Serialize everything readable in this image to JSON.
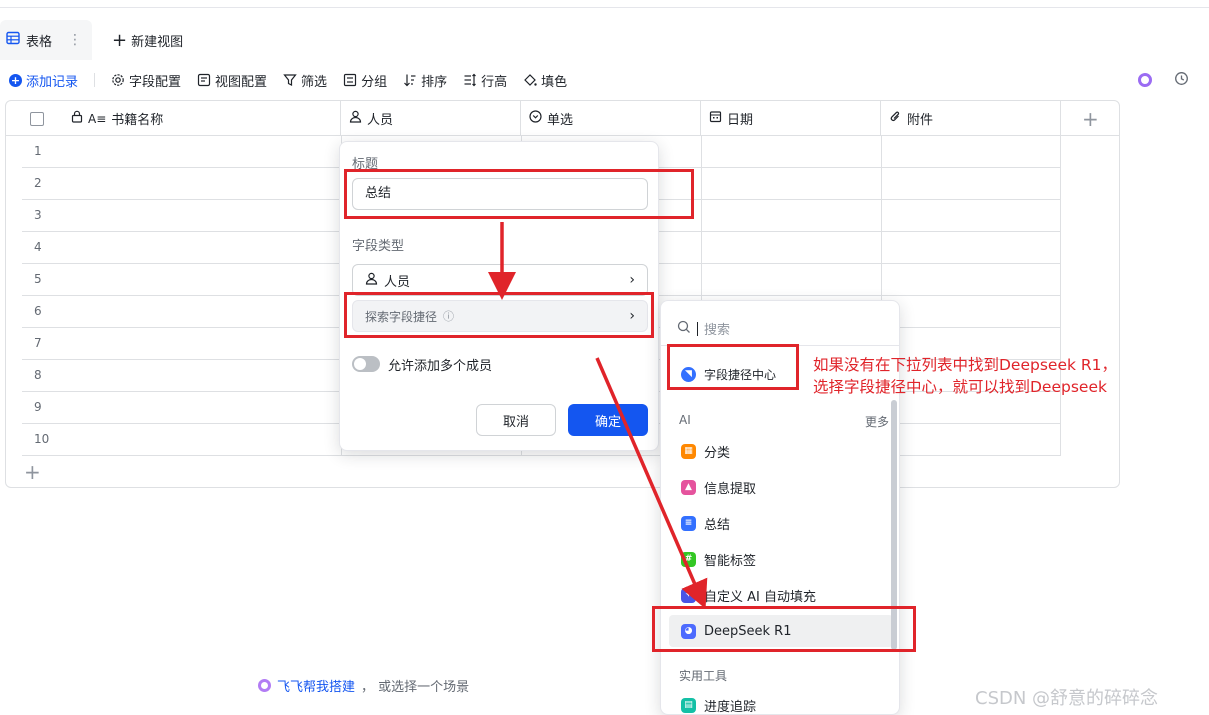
{
  "tabs": {
    "active_label": "表格",
    "more": "⋮",
    "new_view_label": "新建视图"
  },
  "toolbar": {
    "add_record": "添加记录",
    "field_config": "字段配置",
    "view_config": "视图配置",
    "filter": "筛选",
    "group": "分组",
    "sort": "排序",
    "row_height": "行高",
    "fill_color": "填色"
  },
  "grid": {
    "columns": [
      "书籍名称",
      "人员",
      "单选",
      "日期",
      "附件"
    ],
    "row_numbers": [
      "1",
      "2",
      "3",
      "4",
      "5",
      "6",
      "7",
      "8",
      "9",
      "10"
    ],
    "add_row": "+",
    "add_column": "+"
  },
  "field_popover": {
    "title_label": "标题",
    "title_value": "总结",
    "type_label": "字段类型",
    "type_value": "人员",
    "explore_label": "探索字段捷径",
    "explore_info": "ⓘ",
    "allow_multi_label": "允许添加多个成员",
    "cancel": "取消",
    "confirm": "确定"
  },
  "shortcut_dropdown": {
    "search_placeholder": "搜索",
    "center_item": "字段捷径中心",
    "ai_section": "AI",
    "more": "更多",
    "items": [
      {
        "label": "分类",
        "color": "#ff8800"
      },
      {
        "label": "信息提取",
        "color": "#e5539d"
      },
      {
        "label": "总结",
        "color": "#3370ff"
      },
      {
        "label": "智能标签",
        "color": "#34c724"
      },
      {
        "label": "自定义 AI 自动填充",
        "color": "#4954e6"
      },
      {
        "label": "DeepSeek R1",
        "color": "#4d6bfe"
      }
    ],
    "tools_section": "实用工具",
    "tool_items": [
      {
        "label": "进度追踪",
        "color": "#14c0a6"
      }
    ]
  },
  "annotation": {
    "line1": "如果没有在下拉列表中找到Deepseek R1，",
    "line2": "选择字段捷径中心，就可以找到Deepseek",
    "color": "#e0242a"
  },
  "footer": {
    "link": "飞飞帮我搭建",
    "rest": "，  或选择一个场景"
  },
  "watermark": "CSDN @舒意的碎碎念"
}
